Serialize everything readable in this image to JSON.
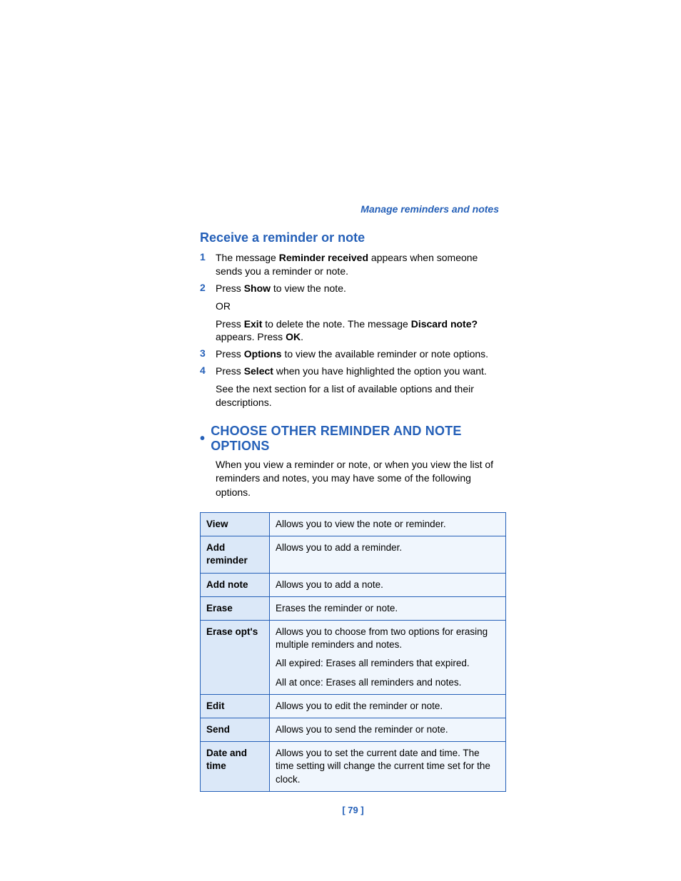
{
  "header": "Manage reminders and notes",
  "section_title": "Receive a reminder or note",
  "steps": [
    {
      "num": "1",
      "parts": [
        {
          "t": "The message "
        },
        {
          "b": "Reminder received"
        },
        {
          "t": " appears when someone sends you a reminder or note."
        }
      ]
    },
    {
      "num": "2",
      "parts": [
        {
          "t": "Press "
        },
        {
          "b": "Show"
        },
        {
          "t": " to view the note."
        }
      ],
      "subs": [
        [
          {
            "t": "OR"
          }
        ],
        [
          {
            "t": "Press "
          },
          {
            "b": "Exit"
          },
          {
            "t": " to delete the note. The message "
          },
          {
            "b": "Discard note?"
          },
          {
            "t": " appears. Press "
          },
          {
            "b": "OK"
          },
          {
            "t": "."
          }
        ]
      ]
    },
    {
      "num": "3",
      "parts": [
        {
          "t": "Press "
        },
        {
          "b": "Options"
        },
        {
          "t": " to view the available reminder or note options."
        }
      ]
    },
    {
      "num": "4",
      "parts": [
        {
          "t": "Press "
        },
        {
          "b": "Select"
        },
        {
          "t": " when you have highlighted the option you want."
        }
      ],
      "subs": [
        [
          {
            "t": "See the next section for a list of available options and their descriptions."
          }
        ]
      ]
    }
  ],
  "major_title": "CHOOSE OTHER REMINDER AND NOTE OPTIONS",
  "intro": "When you view a reminder or note, or when you view the list of reminders and notes, you may have some of the following options.",
  "options": [
    {
      "label": "View",
      "desc": "Allows you to view the note or reminder."
    },
    {
      "label": "Add reminder",
      "desc": "Allows you to add a reminder."
    },
    {
      "label": "Add note",
      "desc": "Allows you to add a note."
    },
    {
      "label": "Erase",
      "desc": "Erases the reminder or note."
    },
    {
      "label": "Erase opt's",
      "desc_multi": [
        "Allows you to choose from two options for erasing multiple reminders and notes.",
        "All expired: Erases all reminders that expired.",
        "All at once: Erases all reminders and notes."
      ]
    },
    {
      "label": "Edit",
      "desc": "Allows you to edit the reminder or note."
    },
    {
      "label": "Send",
      "desc": " Allows you to send the reminder or note."
    },
    {
      "label": "Date and time",
      "desc": "Allows you to set the current date and time. The time setting will change the current time set for the clock."
    }
  ],
  "page_number": "[ 79 ]"
}
